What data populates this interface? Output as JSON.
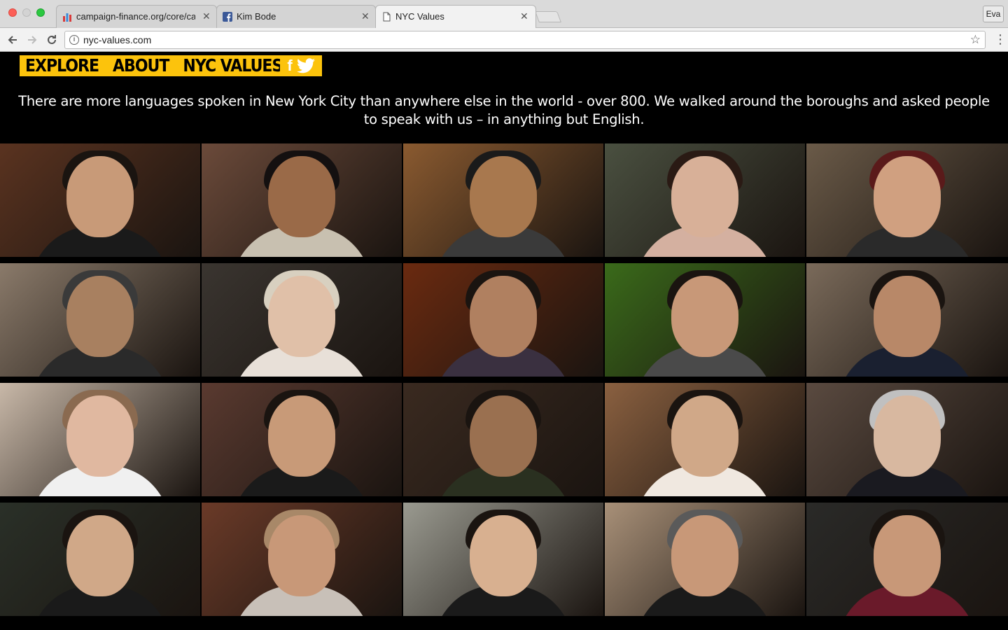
{
  "browser": {
    "tabs": [
      {
        "title": "campaign-finance.org/core/ca",
        "favicon": "bars-chart-icon",
        "close": "✕"
      },
      {
        "title": "Kim Bode",
        "favicon": "facebook-icon",
        "close": "✕"
      },
      {
        "title": "NYC Values",
        "favicon": "document-icon",
        "close": "✕"
      }
    ],
    "profile_name": "Eva",
    "url": "nyc-values.com"
  },
  "site": {
    "nav": {
      "explore": "EXPLORE",
      "about": "ABOUT",
      "nyc_values": "NYC VALUES"
    },
    "social": {
      "facebook": "f"
    },
    "intro": "There are more languages spoken in New York City than anywhere else in the world - over 800. We walked around the boroughs and asked people to speak with us – in anything but English.",
    "accent_color": "#fcc30c"
  },
  "portraits": [
    {
      "bg": "#5a3320",
      "skin": "#c89a78",
      "hair": "#1a1410",
      "shirt": "#1a1a1a"
    },
    {
      "bg": "#6b4a3a",
      "skin": "#9a6a48",
      "hair": "#141010",
      "shirt": "#c8c0b0"
    },
    {
      "bg": "#8a5a30",
      "skin": "#a8784e",
      "hair": "#1a1a1a",
      "shirt": "#3a3a3a"
    },
    {
      "bg": "#4a5040",
      "skin": "#d8b098",
      "hair": "#2a1a14",
      "shirt": "#d4b0a0"
    },
    {
      "bg": "#6a5a48",
      "skin": "#d0a080",
      "hair": "#5a1a1a",
      "shirt": "#2a2a2a"
    },
    {
      "bg": "#8a7a6a",
      "skin": "#a88060",
      "hair": "#3a3a3a",
      "shirt": "#2a2a2a"
    },
    {
      "bg": "#3a3530",
      "skin": "#e0c0a8",
      "hair": "#d8d0c0",
      "shirt": "#e8e0d8"
    },
    {
      "bg": "#6a2a10",
      "skin": "#b08060",
      "hair": "#1a1410",
      "shirt": "#3a3040"
    },
    {
      "bg": "#3a6a1a",
      "skin": "#c89878",
      "hair": "#1a1410",
      "shirt": "#4a4a4a"
    },
    {
      "bg": "#7a6a5a",
      "skin": "#b88868",
      "hair": "#1a1410",
      "shirt": "#1a2030"
    },
    {
      "bg": "#c8b8a8",
      "skin": "#e0b8a0",
      "hair": "#8a6a50",
      "shirt": "#f0f0f0"
    },
    {
      "bg": "#5a3a30",
      "skin": "#c89a78",
      "hair": "#1a1410",
      "shirt": "#1a1a1a"
    },
    {
      "bg": "#3a2a20",
      "skin": "#9a7050",
      "hair": "#1a1410",
      "shirt": "#2a3020"
    },
    {
      "bg": "#8a6040",
      "skin": "#d0a888",
      "hair": "#1a1410",
      "shirt": "#f0e8e0"
    },
    {
      "bg": "#5a4a40",
      "skin": "#d8b8a0",
      "hair": "#c0c0c0",
      "shirt": "#1a1a20"
    },
    {
      "bg": "#2a3028",
      "skin": "#d0a888",
      "hair": "#1a1410",
      "shirt": "#1a1a1a"
    },
    {
      "bg": "#6a3a28",
      "skin": "#c89878",
      "hair": "#a88868",
      "shirt": "#c8c0b8"
    },
    {
      "bg": "#9a9a90",
      "skin": "#d8b090",
      "hair": "#1a1410",
      "shirt": "#1a1a1a"
    },
    {
      "bg": "#a89078",
      "skin": "#c89878",
      "hair": "#5a5a5a",
      "shirt": "#1a1a1a"
    },
    {
      "bg": "#2a2a28",
      "skin": "#c89878",
      "hair": "#1a1410",
      "shirt": "#6a1a2a"
    }
  ]
}
